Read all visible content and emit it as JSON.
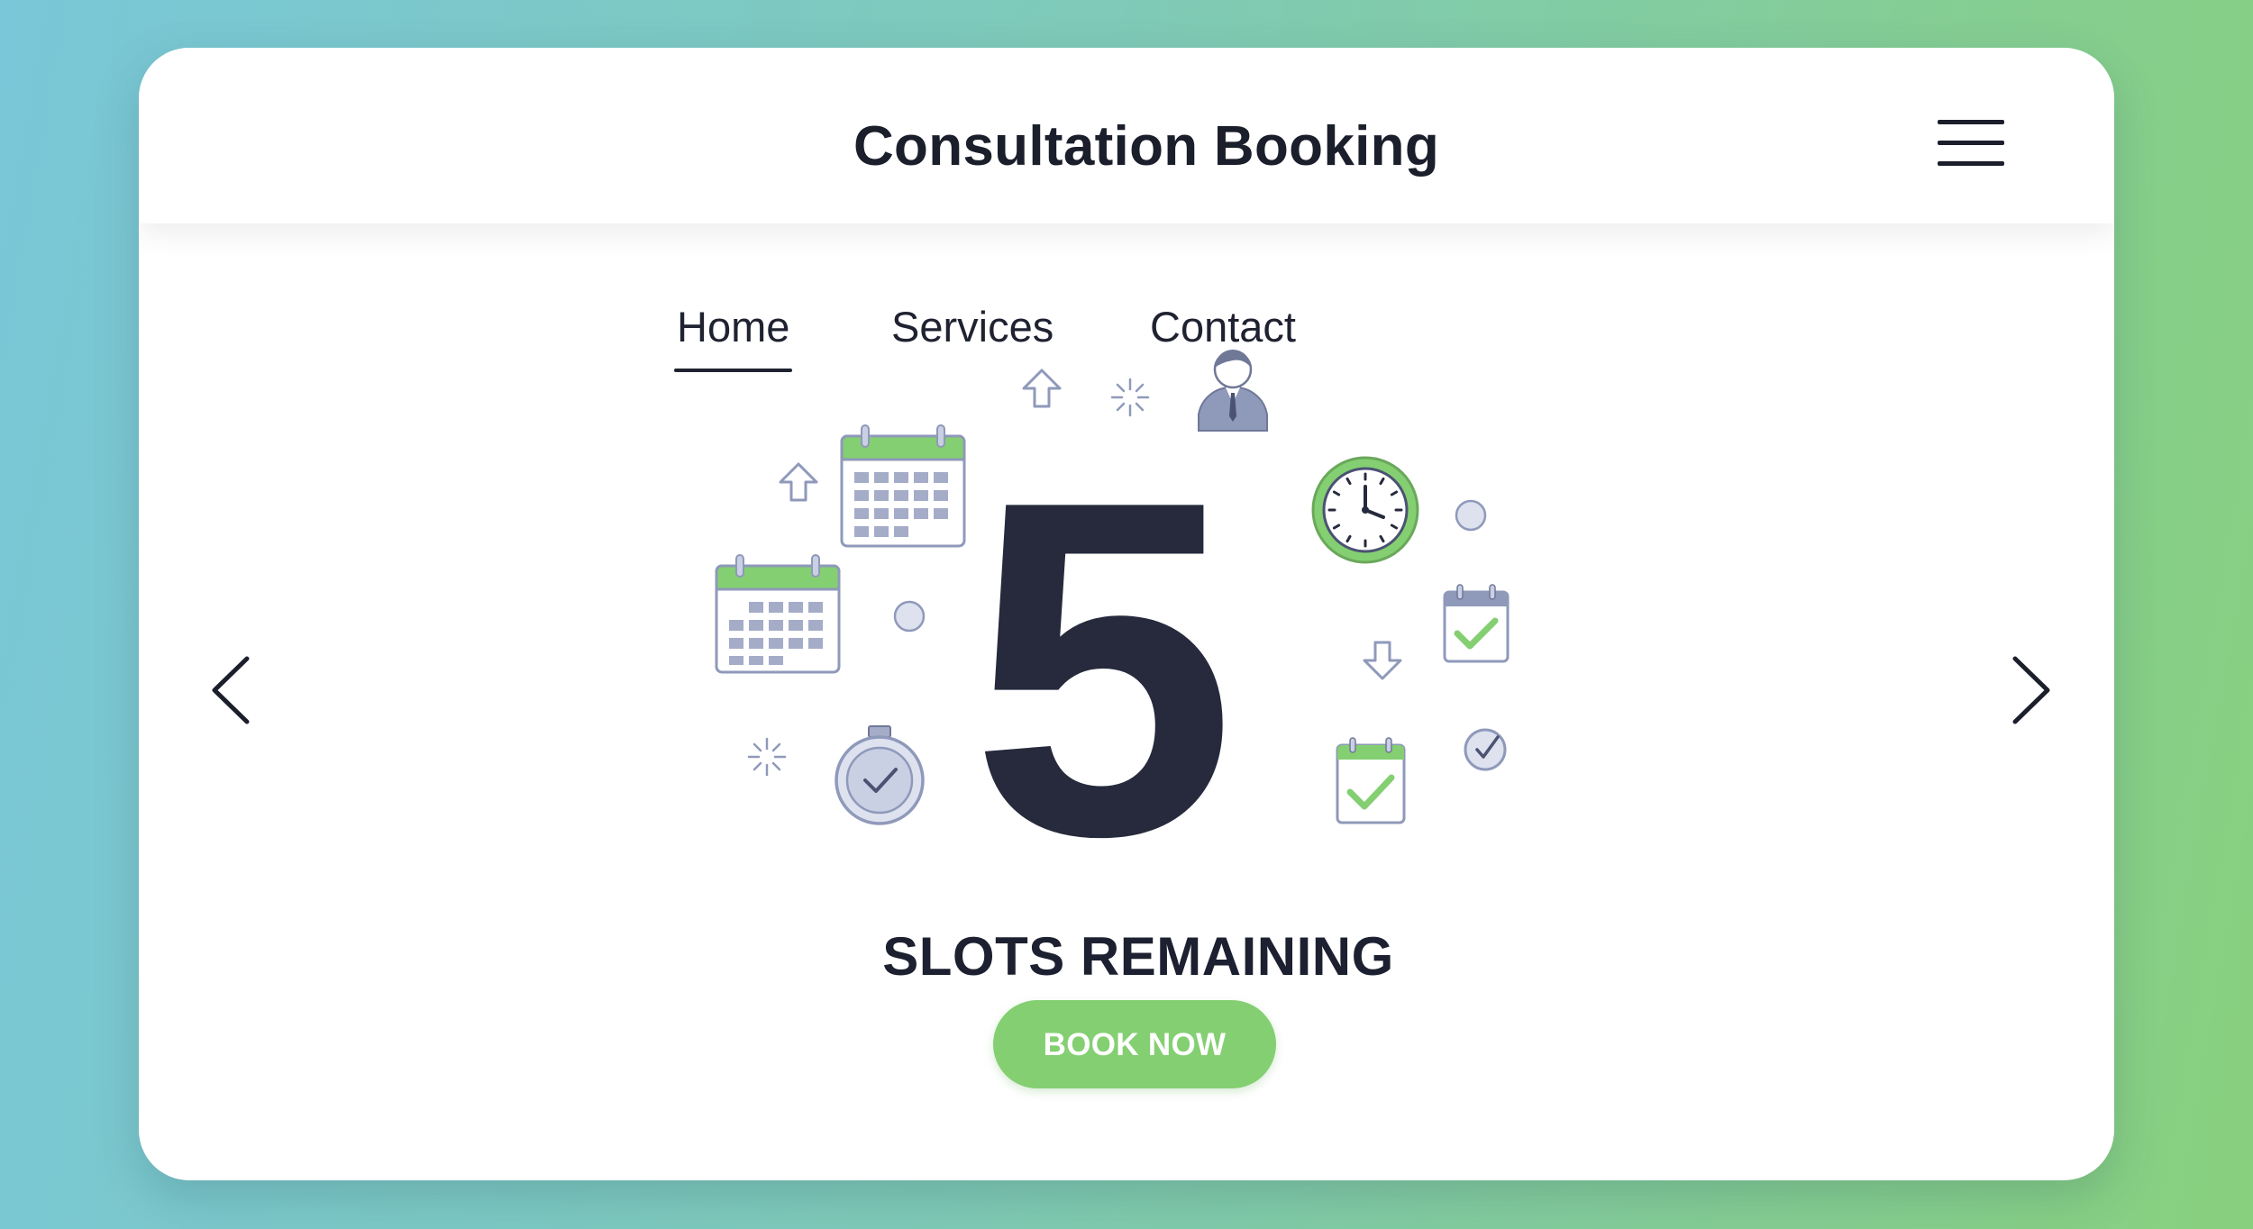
{
  "header": {
    "title": "Consultation Booking",
    "menu_icon": "hamburger-menu-icon"
  },
  "nav": {
    "items": [
      {
        "label": "Home",
        "active": true
      },
      {
        "label": "Services",
        "active": false
      },
      {
        "label": "Contact",
        "active": false
      }
    ]
  },
  "carousel": {
    "prev_icon": "chevron-left-icon",
    "next_icon": "chevron-right-icon"
  },
  "hero": {
    "count": "5",
    "label": "SLOTS REMAINING",
    "icons": [
      "calendar-icon",
      "calendar-check-icon",
      "clock-icon",
      "stopwatch-icon",
      "consultant-avatar-icon",
      "arrow-up-icon",
      "arrow-down-icon",
      "sparkle-icon",
      "check-circle-icon",
      "dot-icon"
    ]
  },
  "cta": {
    "label": "BOOK NOW",
    "color": "#84cf72"
  },
  "colors": {
    "accent_green": "#84cf72",
    "text_dark": "#262a3c",
    "icon_slate": "#8f99ba"
  }
}
